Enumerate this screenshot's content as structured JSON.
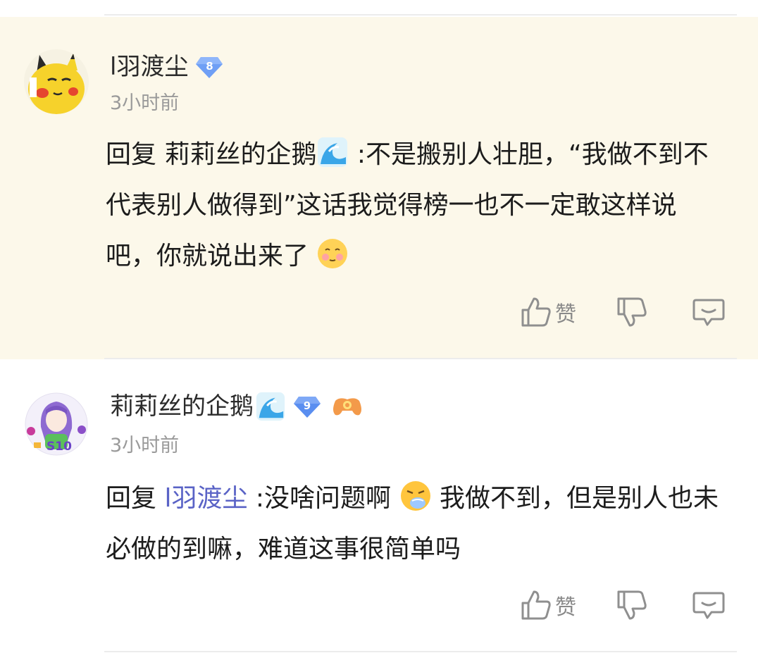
{
  "comments": [
    {
      "username": "l羽渡尘",
      "level": "8",
      "time": "3小时前",
      "reply_prefix": "回复",
      "mention": "莉莉丝的企鹅",
      "text_part1": " :不是搬别人壮胆，“我做不到不代表别人做得到”这话我觉得榜一也不一定敢这样说吧，你就说出来了",
      "trailing_emoji_icon": "blush-face-emoji",
      "like_label": "赞"
    },
    {
      "username": "莉莉丝的企鹅",
      "name_emoji_icon": "wave-emoji",
      "level": "9",
      "fan_badge_icon": "game-controller-badge",
      "avatar_badge_text": "S10",
      "time": "3小时前",
      "reply_prefix": "回复",
      "mention": "l羽渡尘",
      "text_part1": " :没啥问题啊",
      "mid_emoji_icon": "sneezing-face-emoji",
      "text_part2": "我做不到，但是别人也未必做的到嘛，难道这事很简单吗",
      "like_label": "赞"
    }
  ],
  "colors": {
    "highlight_background": "#fcf8ea",
    "mention_link": "#5a63c6",
    "level_badge_8": "#6f9ff5",
    "level_badge_9": "#5a8ef0",
    "muted_text": "#9a9a9a"
  }
}
